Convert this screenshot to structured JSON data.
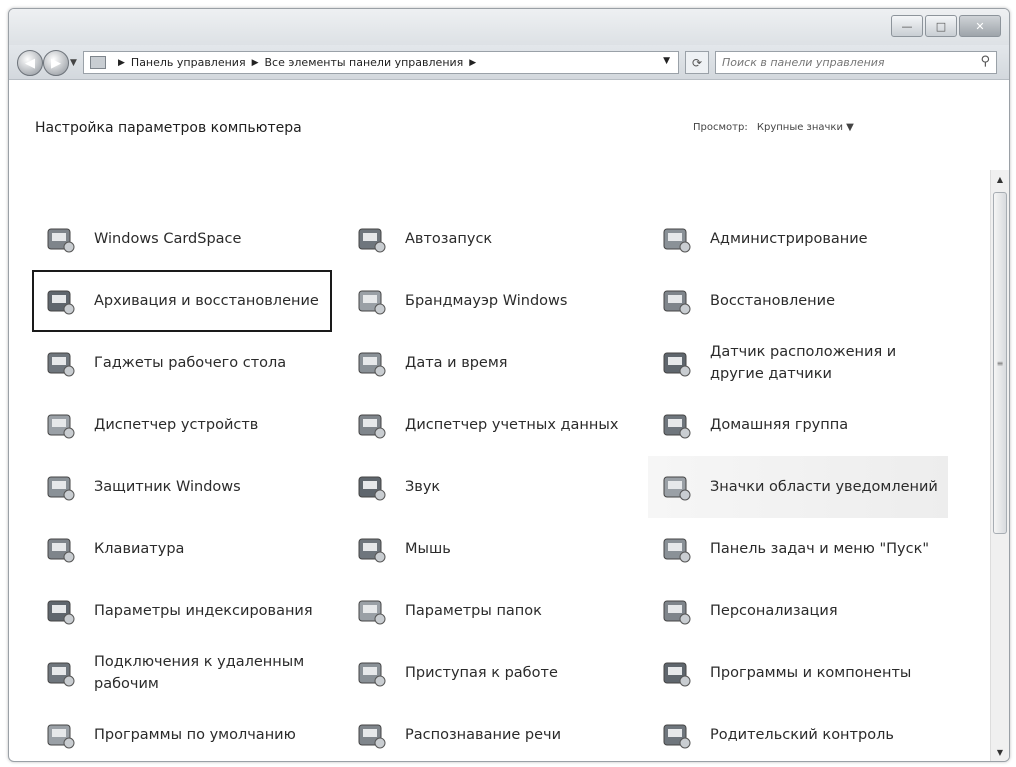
{
  "window": {
    "controls": {
      "minimize": "—",
      "maximize": "□",
      "close": "✕"
    }
  },
  "nav": {
    "breadcrumb": [
      "Панель управления",
      "Все элементы панели управления"
    ],
    "search_placeholder": "Поиск в панели управления"
  },
  "header": {
    "title": "Настройка параметров компьютера",
    "view_by_label": "Просмотр:",
    "view_by_value": "Крупные значки"
  },
  "items": [
    {
      "label": "Windows CardSpace",
      "icon": "cardspace-icon"
    },
    {
      "label": "Автозапуск",
      "icon": "autoplay-icon"
    },
    {
      "label": "Администрирование",
      "icon": "admin-tools-icon"
    },
    {
      "label": "Архивация и восстановление",
      "icon": "backup-icon",
      "selected": true
    },
    {
      "label": "Брандмауэр Windows",
      "icon": "firewall-icon"
    },
    {
      "label": "Восстановление",
      "icon": "recovery-icon"
    },
    {
      "label": "Гаджеты рабочего стола",
      "icon": "gadgets-icon"
    },
    {
      "label": "Дата и время",
      "icon": "calendar-clock-icon"
    },
    {
      "label": "Датчик расположения и другие датчики",
      "icon": "sensor-icon"
    },
    {
      "label": "Диспетчер устройств",
      "icon": "device-manager-icon"
    },
    {
      "label": "Диспетчер учетных данных",
      "icon": "credential-vault-icon"
    },
    {
      "label": "Домашняя группа",
      "icon": "homegroup-icon"
    },
    {
      "label": "Защитник Windows",
      "icon": "defender-icon"
    },
    {
      "label": "Звук",
      "icon": "speaker-icon"
    },
    {
      "label": "Значки области уведомлений",
      "icon": "notification-area-icon",
      "hover": true
    },
    {
      "label": "Клавиатура",
      "icon": "keyboard-icon"
    },
    {
      "label": "Мышь",
      "icon": "mouse-icon"
    },
    {
      "label": "Панель задач и меню \"Пуск\"",
      "icon": "taskbar-icon"
    },
    {
      "label": "Параметры индексирования",
      "icon": "indexing-icon"
    },
    {
      "label": "Параметры папок",
      "icon": "folder-options-icon"
    },
    {
      "label": "Персонализация",
      "icon": "personalization-icon"
    },
    {
      "label": "Подключения к удаленным рабочим",
      "icon": "remote-desktop-icon"
    },
    {
      "label": "Приступая к работе",
      "icon": "getting-started-icon"
    },
    {
      "label": "Программы и компоненты",
      "icon": "programs-icon"
    },
    {
      "label": "Программы по умолчанию",
      "icon": "default-programs-icon"
    },
    {
      "label": "Распознавание речи",
      "icon": "microphone-icon"
    },
    {
      "label": "Родительский контроль",
      "icon": "parental-controls-icon"
    }
  ]
}
